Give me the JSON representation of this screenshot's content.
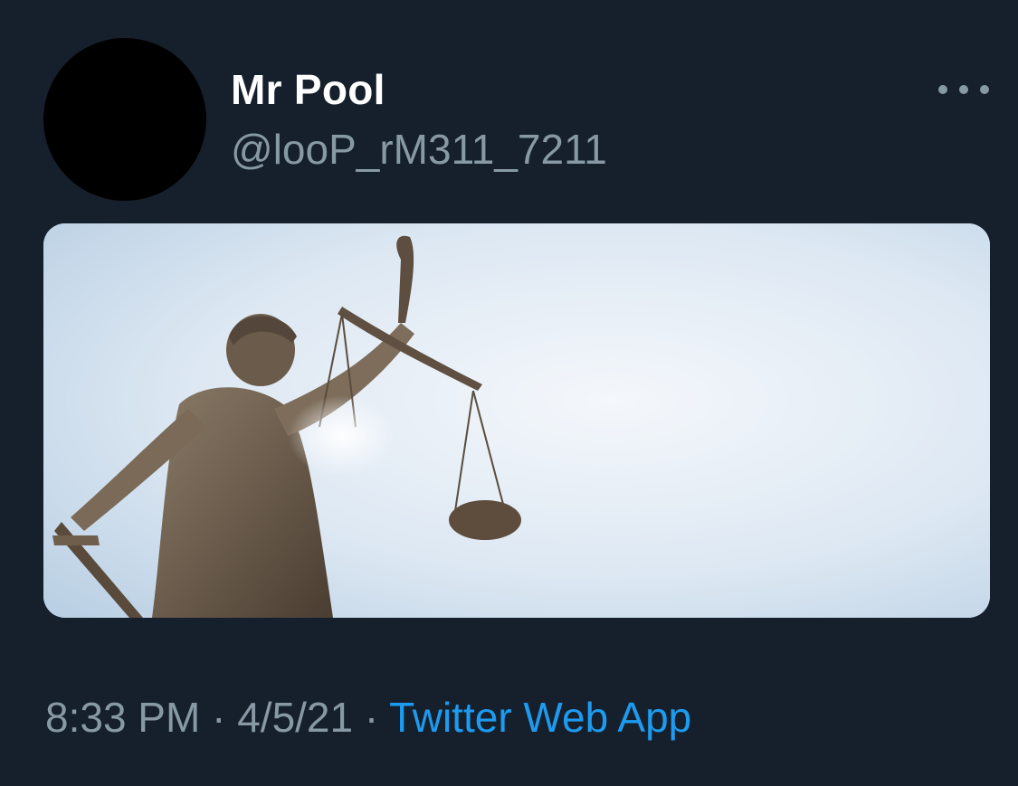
{
  "user": {
    "display_name": "Mr Pool",
    "handle": "@looP_rM311_7211"
  },
  "tweet": {
    "time": "8:33 PM",
    "separator": " · ",
    "date": "4/5/21",
    "source": "Twitter Web App"
  },
  "icons": {
    "more": "more-options-icon"
  },
  "colors": {
    "background": "#16202c",
    "name": "#ffffff",
    "secondary_text": "#8899a6",
    "link": "#1d9bf0"
  }
}
